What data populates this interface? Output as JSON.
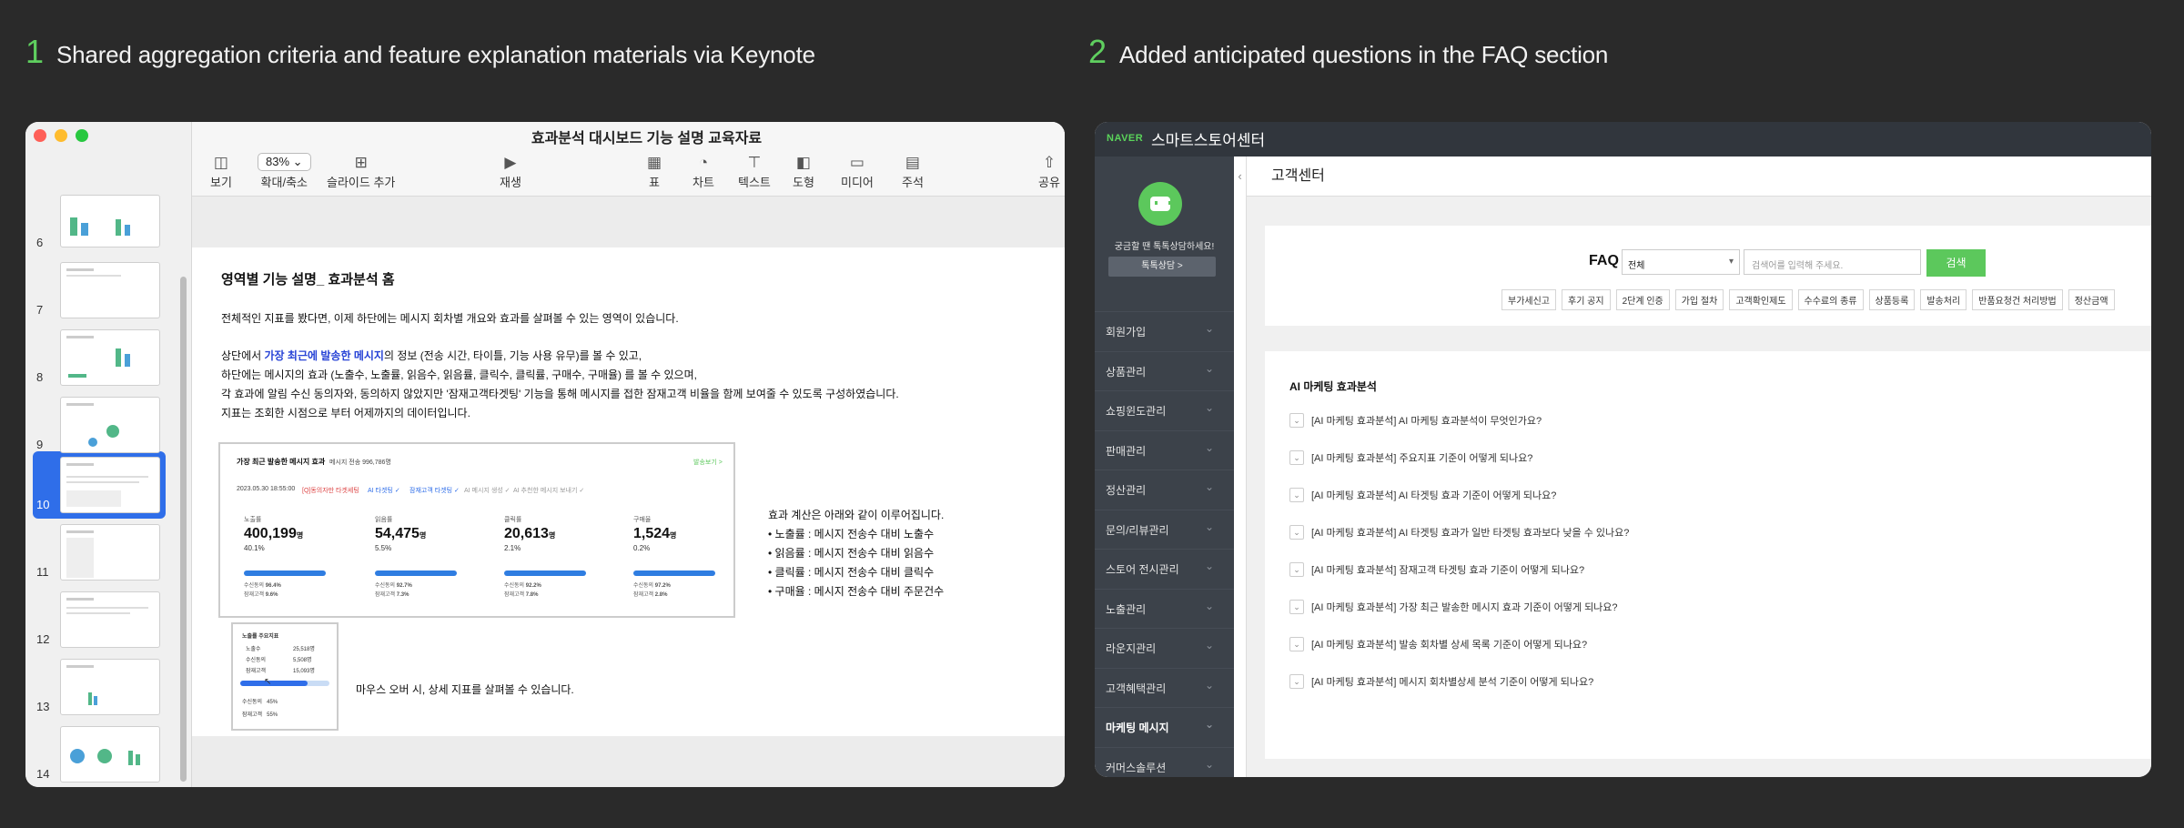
{
  "headers": [
    {
      "num": "1",
      "title": "Shared aggregation criteria and feature explanation materials via Keynote"
    },
    {
      "num": "2",
      "title": "Added anticipated questions in the FAQ section"
    }
  ],
  "keynote": {
    "doc_title": "효과분석 대시보드 기능 설명 교육자료",
    "toolbar": {
      "view": "보기",
      "zoom_value": "83%",
      "zoom_label": "확대/축소",
      "add_slide": "슬라이드 추가",
      "play": "재생",
      "table": "표",
      "chart": "차트",
      "text": "텍스트",
      "shape": "도형",
      "media": "미디어",
      "comment": "주석",
      "share": "공유"
    },
    "slides": [
      "6",
      "7",
      "8",
      "9",
      "10",
      "11",
      "12",
      "13",
      "14"
    ],
    "selected_slide": "10",
    "slide": {
      "heading": "영역별 기능 설명_ 효과분석 홈",
      "p1": "전체적인 지표를 봤다면, 이제 하단에는 메시지 회차별 개요와 효과를 살펴볼 수 있는 영역이 있습니다.",
      "p2_pre": "상단에서 ",
      "p2_hl": "가장 최근에 발송한 메시지",
      "p2_post": "의 정보 (전송 시간, 타이틀, 기능 사용 유무)를 볼 수 있고,",
      "p3": "하단에는 메시지의 효과 (노출수, 노출률, 읽음수, 읽음률, 클릭수, 클릭률, 구매수, 구매율) 를 볼 수 있으며,",
      "p4": "각 효과에 알림 수신 동의자와, 동의하지 않았지만 '잠재고객타겟팅' 기능을 통해 메시지를 접한 잠재고객 비율을 함께 보여줄 수 있도록 구성하였습니다.",
      "p5": "지표는 조회한 시점으로 부터 어제까지의 데이터입니다.",
      "shot": {
        "title": "가장 최근 발송한 메시지 효과",
        "sub": "메시지 전송 996,786명",
        "link": "발송보기 >",
        "date": "2023.05.30 18:55:00",
        "tag1": "[Q]동의자만 타겟세팅",
        "tag2": "AI 타겟팅 ✓",
        "tag3": "잠재고객 타겟팅 ✓",
        "tag4": "AI 메시지 생성 ✓",
        "tag5": "AI 추천한 메시지 보내기 ✓",
        "metrics": [
          {
            "label": "노출률",
            "value": "400,199",
            "unit": "명",
            "pct": "40.1%",
            "a": "96.4%",
            "b": "9.6%"
          },
          {
            "label": "읽음률",
            "value": "54,475",
            "unit": "명",
            "pct": "5.5%",
            "a": "92.7%",
            "b": "7.3%"
          },
          {
            "label": "클릭률",
            "value": "20,613",
            "unit": "명",
            "pct": "2.1%",
            "a": "92.2%",
            "b": "7.8%"
          },
          {
            "label": "구매율",
            "value": "1,524",
            "unit": "명",
            "pct": "0.2%",
            "a": "97.2%",
            "b": "2.8%"
          }
        ],
        "sub_a": "수신동의",
        "sub_b": "잠재고객"
      },
      "explain_title": "효과 계산은 아래와 같이 이루어집니다.",
      "explain_items": [
        "노출률 : 메시지 전송수 대비 노출수",
        "읽음률 : 메시지 전송수 대비 읽음수",
        "클릭률 : 메시지 전송수 대비 클릭수",
        "구매율 : 메시지 전송수 대비 주문건수"
      ],
      "mini": {
        "title": "노출률 주요지표",
        "r1": "노출수",
        "r1v": "25,518명",
        "r2": "수신동의",
        "r2v": "5,508명",
        "r3": "잠재고객",
        "r3v": "15,093명",
        "p1": "수신동의",
        "p1v": "45%",
        "p2": "잠재고객",
        "p2v": "55%"
      },
      "hover_note": "마우스 오버 시, 상세 지표를 살펴볼 수 있습니다."
    }
  },
  "smartstore": {
    "naver": "NAVER",
    "name": "스마트스토어센터",
    "side_msg": "궁금할 땐 톡톡상담하세요!",
    "talk_btn": "톡톡상담 >",
    "menu": [
      "회원가입",
      "상품관리",
      "쇼핑윈도관리",
      "판매관리",
      "정산관리",
      "문의/리뷰관리",
      "스토어 전시관리",
      "노출관리",
      "라운지관리",
      "고객혜택관리",
      "마케팅 메시지",
      "커머스솔루션"
    ],
    "page_title": "고객센터",
    "faq_label": "FAQ",
    "faq_select": "전체",
    "faq_placeholder": "검색어를 입력해 주세요.",
    "faq_button": "검색",
    "chips": [
      "부가세신고",
      "후기 공지",
      "2단계 인증",
      "가입 절차",
      "고객확인제도",
      "수수료의 종류",
      "상품등록",
      "발송처리",
      "반품요청건 처리방법",
      "정산금액"
    ],
    "ai_heading": "AI 마케팅 효과분석",
    "questions": [
      "[AI 마케팅 효과분석] AI 마케팅 효과분석이 무엇인가요?",
      "[AI 마케팅 효과분석] 주요지표 기준이 어떻게 되나요?",
      "[AI 마케팅 효과분석] AI 타겟팅 효과 기준이 어떻게 되나요?",
      "[AI 마케팅 효과분석] AI 타겟팅 효과가 일반 타겟팅 효과보다 낮을 수 있나요?",
      "[AI 마케팅 효과분석] 잠재고객 타겟팅 효과 기준이 어떻게 되나요?",
      "[AI 마케팅 효과분석] 가장 최근 발송한 메시지 효과 기준이 어떻게 되나요?",
      "[AI 마케팅 효과분석] 발송 회차별 상세 목록 기준이 어떻게 되나요?",
      "[AI 마케팅 효과분석] 메시지 회차별상세 분석 기준이 어떻게 되나요?"
    ]
  }
}
